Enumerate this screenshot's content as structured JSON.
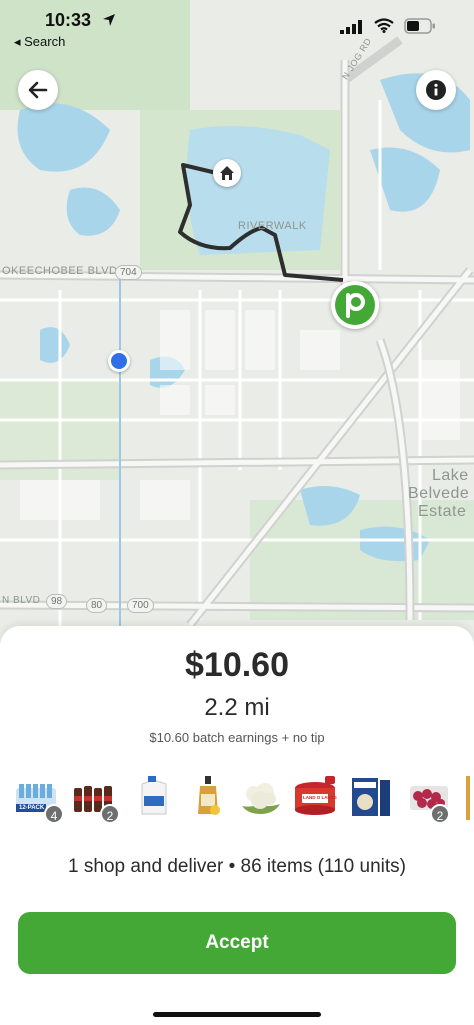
{
  "status_bar": {
    "time": "10:33",
    "back_app": "◂ Search"
  },
  "map": {
    "labels": {
      "okeechobee": "OKEECHOBEE BLVD",
      "riverwalk": "RIVERWALK",
      "jog": "N JOG RD",
      "lake1": "Lake",
      "lake2": "Belvede",
      "lake3": "Estate",
      "blvd_bottom": "N BLVD"
    },
    "shields": {
      "r704": "704",
      "r98": "98",
      "r80": "80",
      "r700": "700"
    },
    "colors": {
      "route": "#2e2e2e",
      "store_pin": "#43a835",
      "user_dot": "#2f6fe8"
    }
  },
  "header": {
    "back_icon": "arrow-left-icon",
    "info_icon": "info-icon"
  },
  "batch": {
    "amount": "$10.60",
    "distance": "2.2 mi",
    "earnings_note": "$10.60 batch earnings + no tip",
    "summary": "1 shop and deliver • 86 items (110 units)",
    "accept_label": "Accept",
    "accent_color": "#43a835"
  },
  "items": [
    {
      "name": "water-12-pack",
      "label": "12-PACK",
      "count": "4"
    },
    {
      "name": "soda-bottles",
      "label": "",
      "count": "2"
    },
    {
      "name": "milk-jug",
      "label": "",
      "count": ""
    },
    {
      "name": "honey-bottle",
      "label": "",
      "count": ""
    },
    {
      "name": "cauliflower",
      "label": "",
      "count": ""
    },
    {
      "name": "land-o-lakes-tub",
      "label": "LAND O LAKES",
      "count": ""
    },
    {
      "name": "cereal-box",
      "label": "",
      "count": ""
    },
    {
      "name": "raspberries",
      "label": "",
      "count": "2"
    }
  ]
}
